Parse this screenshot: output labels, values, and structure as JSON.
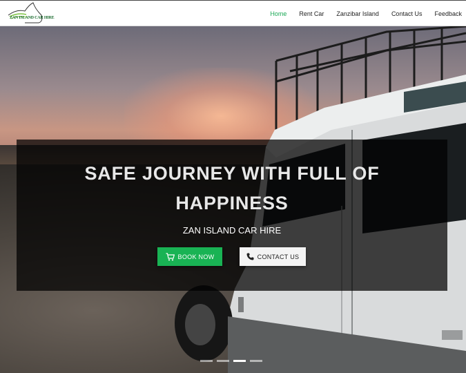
{
  "brand": {
    "logo_text": "ZAN ISLAND CAR HIRE",
    "logo_icon": "island-car-logo"
  },
  "nav": {
    "items": [
      {
        "label": "Home",
        "active": true
      },
      {
        "label": "Rent Car",
        "active": false
      },
      {
        "label": "Zanzibar Island",
        "active": false
      },
      {
        "label": "Contact Us",
        "active": false
      },
      {
        "label": "Feedback",
        "active": false
      }
    ],
    "active_color": "#1aa855"
  },
  "hero": {
    "title_line1": "SAFE JOURNEY WITH FULL OF",
    "title_line2": "HAPPINESS",
    "subtitle": "ZAN ISLAND CAR HIRE",
    "book_button": {
      "label": "BOOK NOW",
      "icon": "cart-icon",
      "color": "#19b354"
    },
    "contact_button": {
      "label": "CONTACT US",
      "icon": "phone-icon"
    },
    "carousel": {
      "slide_count": 4,
      "active_index": 2
    }
  }
}
